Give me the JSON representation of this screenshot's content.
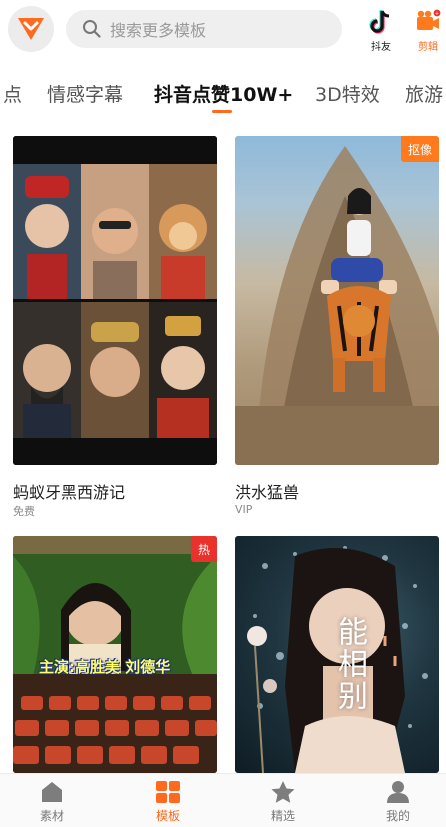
{
  "header": {
    "search_placeholder": "搜索更多模板",
    "tiktok_label": "抖友",
    "edit_label": "剪辑"
  },
  "tabs": [
    "点",
    "情感字幕",
    "抖音点赞10W+",
    "3D特效",
    "旅游"
  ],
  "active_tab": "抖音点赞10W+",
  "cards": [
    {
      "title": "蚂蚁牙黑西游记",
      "subtitle": "免费",
      "badge": ""
    },
    {
      "title": "洪水猛兽",
      "subtitle": "VIP",
      "badge": "抠像"
    },
    {
      "title": "",
      "subtitle": "",
      "badge": "热",
      "overlay_text": "主演:高胜美 刘德华"
    },
    {
      "title": "",
      "subtitle": "",
      "badge": "",
      "overlay_text": "能相别"
    }
  ],
  "nav": [
    {
      "label": "素材",
      "icon": "home-icon"
    },
    {
      "label": "模板",
      "icon": "template-grid-icon"
    },
    {
      "label": "精选",
      "icon": "star-icon"
    },
    {
      "label": "我的",
      "icon": "user-icon"
    }
  ],
  "colors": {
    "accent": "#ff6a1f",
    "hot_badge": "#e8322b",
    "inactive": "#7a7a7a"
  }
}
